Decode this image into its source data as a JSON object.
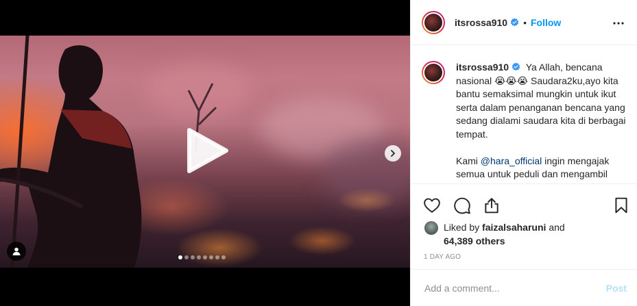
{
  "post": {
    "username": "itsrossa910",
    "follow_label": "Follow",
    "separator": "•"
  },
  "caption": {
    "username": "itsrossa910",
    "text_part1": "Ya Allah, bencana nasional 😭😭😭 Saudara2ku,ayo kita bantu semaksimal mungkin untuk ikut serta dalam penanganan bencana yang sedang dialami saudara kita di berbagai tempat.",
    "text_part2_prefix": "Kami",
    "mention": "@hara_official",
    "text_part2_suffix": "ingin mengajak semua untuk peduli dan mengambil peran dalam bentuk apapun."
  },
  "likes": {
    "prefix": "Liked by",
    "liker": "faizalsaharuni",
    "and": "and",
    "others": "64,389 others"
  },
  "timestamp": "1 DAY AGO",
  "comment": {
    "placeholder": "Add a comment...",
    "post_label": "Post"
  },
  "carousel": {
    "total_slides": 8,
    "active_index": 0
  },
  "colors": {
    "accent": "#0095f6",
    "post_disabled": "#b2dffc",
    "muted": "#8e8e8e"
  },
  "icons": {
    "play": "play-icon",
    "next": "chevron-right-icon",
    "tag": "user-tag-icon",
    "verified": "verified-badge-icon",
    "more": "more-options-icon",
    "like": "heart-icon",
    "comment": "comment-icon",
    "share": "share-icon",
    "save": "bookmark-icon"
  }
}
